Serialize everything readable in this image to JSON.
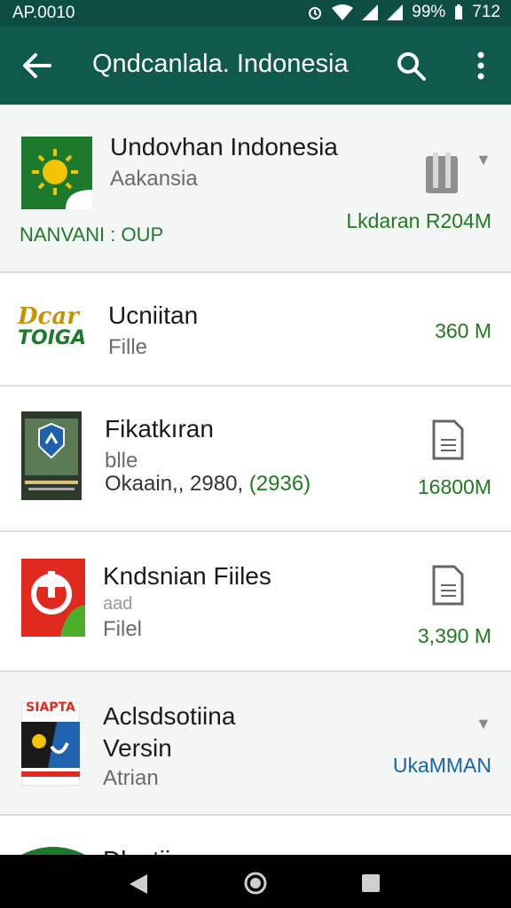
{
  "status_bar": {
    "time": "AP.0010",
    "battery": "99%",
    "extra": "712"
  },
  "app_bar": {
    "title": "Qndcanlala. Indonesia"
  },
  "items": [
    {
      "title": "Undovhan Indonesia",
      "subtitle": "Aakansia",
      "tag": "NANVANI : OUP",
      "size": "Lkdaran R204M",
      "logo_text": ""
    },
    {
      "title": "Ucniitan",
      "subtitle": "Fille",
      "size": "360 M",
      "logo_text_1": "Dcar",
      "logo_text_2": "TOIGA"
    },
    {
      "title": "Fikatkıran",
      "subtitle": "blle",
      "meta_prefix": "Okaain,, 2980,",
      "meta_green": "(2936)",
      "size": "16800M"
    },
    {
      "title": "Kndsnian Fiiles",
      "subtitle": "aad",
      "subtitle2": "Filel",
      "size": "3,390 M"
    },
    {
      "title": "Aclsdsotiina",
      "title2": "Versin",
      "subtitle": "Atrian",
      "size": "UkaMMAN",
      "logo_text": "SIAPTA"
    },
    {
      "title": "Dlsotiian"
    }
  ],
  "colors": {
    "header": "#0f5a4d",
    "status": "#0e4d43",
    "size_green": "#1f7a1f",
    "size_blue": "#1565a8"
  }
}
